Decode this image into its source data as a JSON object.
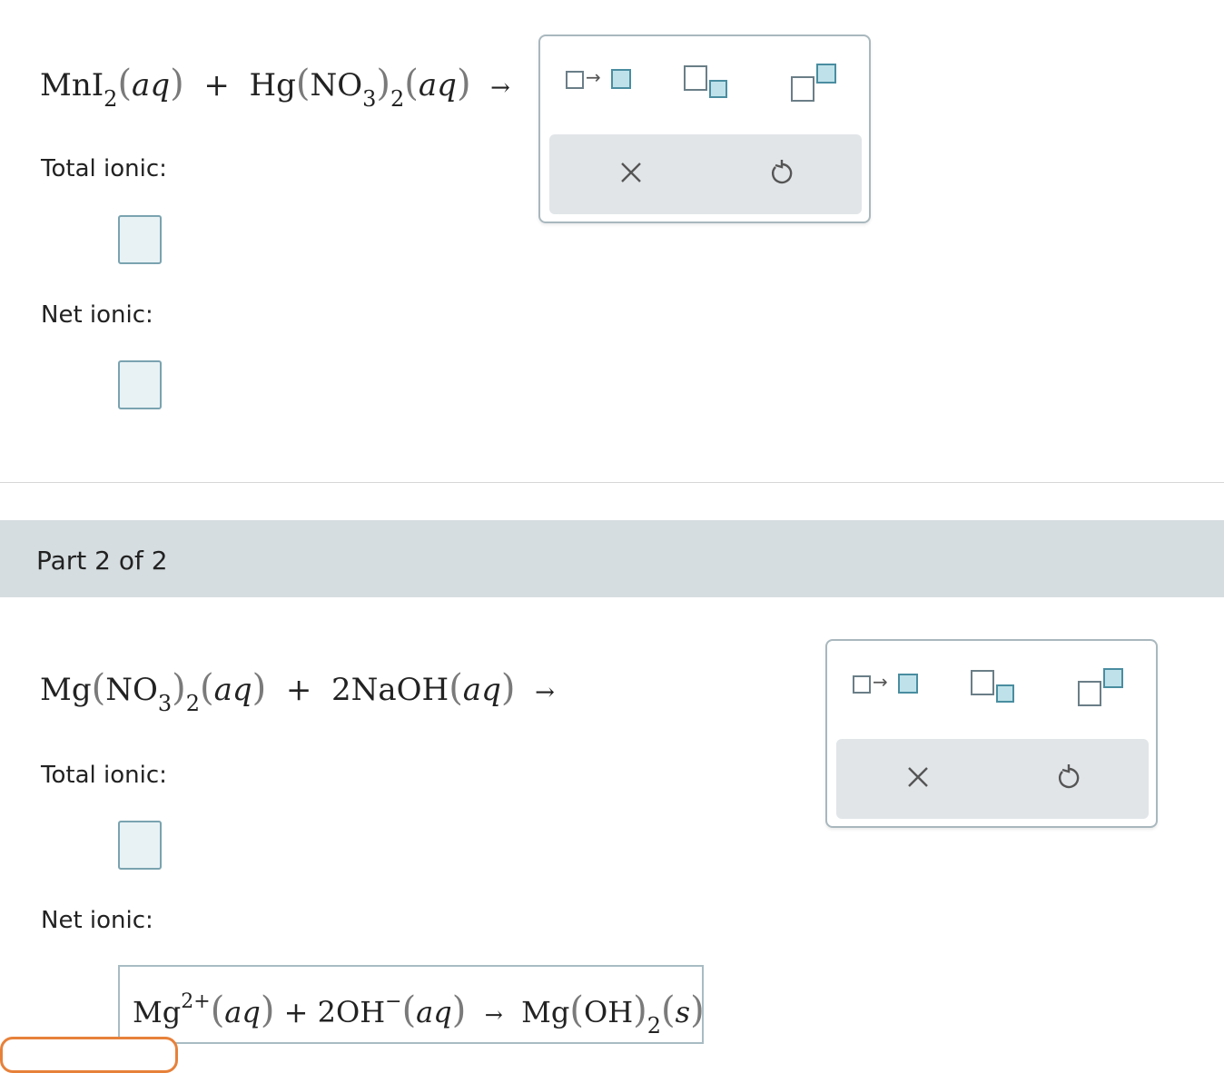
{
  "part1": {
    "reaction": {
      "r1": "MnI",
      "r1_sub": "2",
      "aq": "aq",
      "plus": "+",
      "r2a": "Hg",
      "r2b": "NO",
      "r2b_sub": "3",
      "r2_sub": "2",
      "arrow": "→"
    },
    "total_ionic_label": "Total ionic:",
    "net_ionic_label": "Net ionic:"
  },
  "part2": {
    "title": "Part 2 of 2",
    "reaction": {
      "r1a": "Mg",
      "r1b": "NO",
      "r1b_sub": "3",
      "r1_sub": "2",
      "aq": "aq",
      "plus": "+",
      "r2": "2NaOH",
      "arrow": "→"
    },
    "total_ionic_label": "Total ionic:",
    "net_ionic_label": "Net ionic:",
    "net_ionic_answer": {
      "ion1": "Mg",
      "ion1_charge": "2+",
      "aq": "aq",
      "plus": "+",
      "ion2": "2OH",
      "ion2_charge": "−",
      "arrow": "→",
      "prod": "Mg",
      "prod_group": "OH",
      "prod_sub": "2",
      "state": "s"
    }
  },
  "toolbar": {
    "icons": [
      "reaction-arrow-icon",
      "subscript-icon",
      "superscript-icon",
      "clear-icon",
      "undo-icon"
    ]
  },
  "colors": {
    "accent_blue": "#4a8da0",
    "box_fill": "#e8f2f5",
    "part_bar": "#d6dde0",
    "button_orange": "#e7813a"
  }
}
